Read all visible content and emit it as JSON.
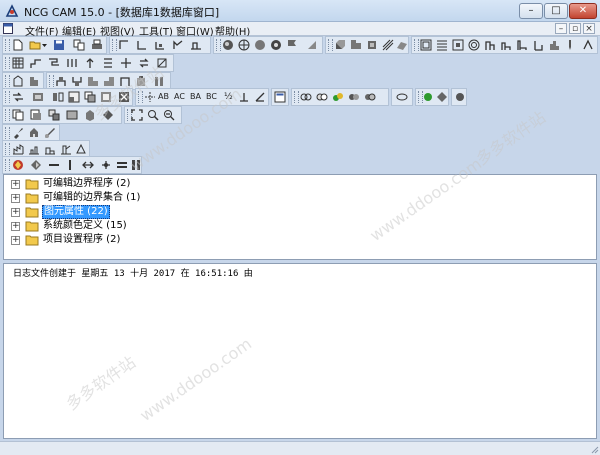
{
  "window": {
    "title": "NCG CAM 15.0 - [数据库1数据库窗口]",
    "controls": {
      "minimize": "–",
      "maximize": "□",
      "close": "✕"
    }
  },
  "menu": {
    "items": [
      {
        "label": "文件(F)"
      },
      {
        "label": "编辑(E)"
      },
      {
        "label": "视图(V)"
      },
      {
        "label": "工具(T)"
      },
      {
        "label": "窗口(W)"
      },
      {
        "label": "帮助(H)"
      }
    ],
    "mdi_controls": {
      "minimize": "–",
      "restore": "▫",
      "close": "×"
    }
  },
  "toolbars": {
    "analysis_text": [
      "AB",
      "AC",
      "BA",
      "BC"
    ],
    "snap_text": "½"
  },
  "tree": {
    "items": [
      {
        "label": "可编辑边界程序 (2)",
        "expander": "+",
        "selected": false
      },
      {
        "label": "可编辑的边界集合 (1)",
        "expander": "+",
        "selected": false
      },
      {
        "label": "图元属性 (22)",
        "expander": "+",
        "selected": true
      },
      {
        "label": "系统颜色定义 (15)",
        "expander": "+",
        "selected": false
      },
      {
        "label": "项目设置程序 (2)",
        "expander": "+",
        "selected": false
      }
    ]
  },
  "log": {
    "lines": [
      "日志文件创建于 星期五 13 十月 2017 在 16:51:16 由"
    ]
  },
  "watermark": {
    "texts": [
      "多多软件站",
      "www.ddooo.com",
      "多多软件站",
      "www.ddooo.com",
      "多多软件站",
      "www.ddooo.com"
    ]
  },
  "colors": {
    "selection": "#3399ff",
    "folder": "#f2c94c",
    "toolbar_bg": "#dfe8f3",
    "window_bg": "#c7d6ea"
  }
}
